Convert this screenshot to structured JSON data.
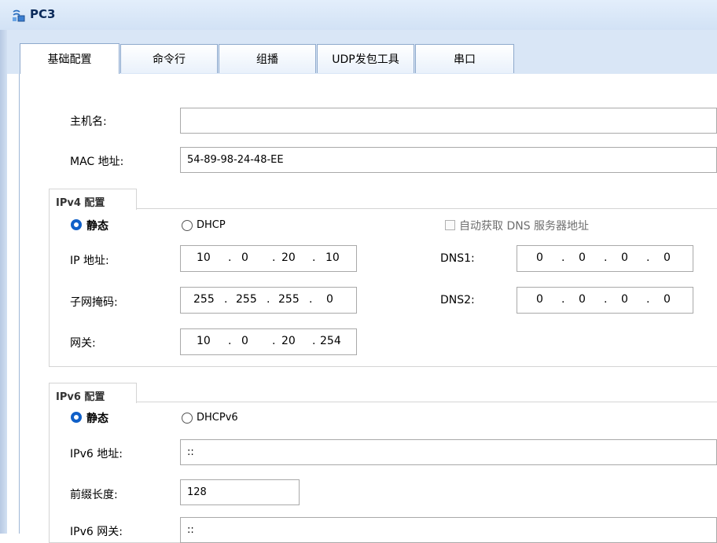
{
  "window": {
    "title": "PC3",
    "icon": "network-pc-icon"
  },
  "tabs": [
    {
      "label": "基础配置",
      "active": true
    },
    {
      "label": "命令行",
      "active": false
    },
    {
      "label": "组播",
      "active": false
    },
    {
      "label": "UDP发包工具",
      "active": false
    },
    {
      "label": "串口",
      "active": false
    }
  ],
  "host": {
    "hostname_label": "主机名:",
    "hostname_value": "",
    "mac_label": "MAC 地址:",
    "mac_value": "54-89-98-24-48-EE"
  },
  "ipv4": {
    "section_title": "IPv4 配置",
    "static_label": "静态",
    "static_selected": true,
    "dhcp_label": "DHCP",
    "auto_dns_label": "自动获取 DNS 服务器地址",
    "auto_dns_checked": false,
    "ip_label": "IP 地址:",
    "ip": [
      "10",
      "0",
      "20",
      "10"
    ],
    "mask_label": "子网掩码:",
    "mask": [
      "255",
      "255",
      "255",
      "0"
    ],
    "gateway_label": "网关:",
    "gateway": [
      "10",
      "0",
      "20",
      "254"
    ],
    "dns1_label": "DNS1:",
    "dns1": [
      "0",
      "0",
      "0",
      "0"
    ],
    "dns2_label": "DNS2:",
    "dns2": [
      "0",
      "0",
      "0",
      "0"
    ]
  },
  "ipv6": {
    "section_title": "IPv6 配置",
    "static_label": "静态",
    "static_selected": true,
    "dhcp_label": "DHCPv6",
    "addr_label": "IPv6 地址:",
    "addr_value": "::",
    "prefix_label": "前缀长度:",
    "prefix_value": "128",
    "gateway_label": "IPv6 网关:",
    "gateway_value": "::"
  },
  "colors": {
    "accent": "#1060c8",
    "titlebar": "#d2e2f5",
    "tabbar": "#d9e6f6"
  }
}
